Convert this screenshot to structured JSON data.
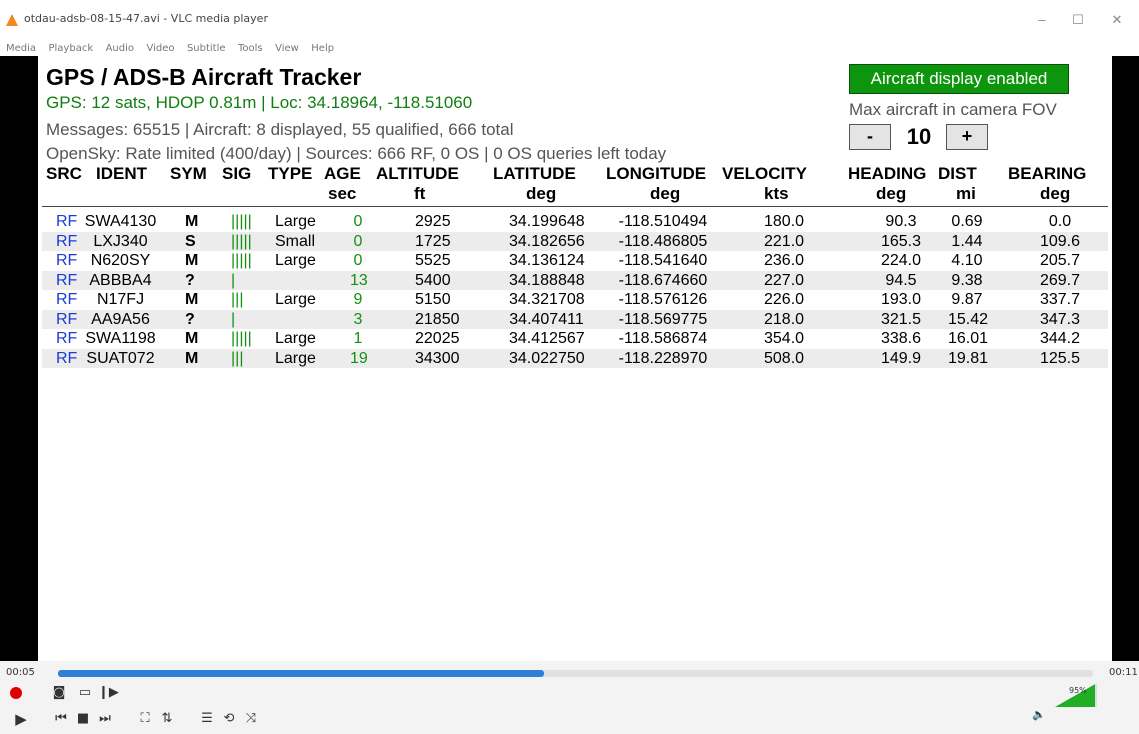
{
  "window": {
    "title": "otdau-adsb-08-15-47.avi - VLC media player",
    "minimize": "–",
    "maximize": "☐",
    "close": "✕"
  },
  "menu": [
    "Media",
    "Playback",
    "Audio",
    "Video",
    "Subtitle",
    "Tools",
    "View",
    "Help"
  ],
  "tracker": {
    "title": "GPS / ADS-B Aircraft Tracker",
    "gps_line": "GPS: 12 sats, HDOP 0.81m  |  Loc: 34.18964, -118.51060",
    "messages_line": "Messages: 65515  |  Aircraft: 8 displayed, 55 qualified, 666 total",
    "opensky_line": "OpenSky: Rate limited (400/day)  |  Sources: 666 RF, 0 OS  |  0 OS queries left today",
    "display_enabled": "Aircraft display enabled",
    "max_fov_label": "Max aircraft in camera FOV",
    "minus": "-",
    "plus": "+",
    "max_value": "10"
  },
  "table": {
    "headers": [
      "SRC",
      "IDENT",
      "SYM",
      "SIG",
      "TYPE",
      "AGE",
      "ALTITUDE",
      "LATITUDE",
      "LONGITUDE",
      "VELOCITY",
      "HEADING",
      "DIST",
      "BEARING"
    ],
    "units": [
      "",
      "",
      "",
      "",
      "",
      "sec",
      "ft",
      "deg",
      "deg",
      "kts",
      "deg",
      "mi",
      "deg"
    ],
    "rows": [
      [
        "RF",
        "SWA4130",
        "M",
        "|||||",
        "Large",
        "0",
        "2925",
        "34.199648",
        "-118.510494",
        "180.0",
        "90.3",
        "0.69",
        "0.0"
      ],
      [
        "RF",
        "LXJ340",
        "S",
        "|||||",
        "Small",
        "0",
        "1725",
        "34.182656",
        "-118.486805",
        "221.0",
        "165.3",
        "1.44",
        "109.6"
      ],
      [
        "RF",
        "N620SY",
        "M",
        "|||||",
        "Large",
        "0",
        "5525",
        "34.136124",
        "-118.541640",
        "236.0",
        "224.0",
        "4.10",
        "205.7"
      ],
      [
        "RF",
        "ABBBA4",
        "?",
        "|",
        "",
        "13",
        "5400",
        "34.188848",
        "-118.674660",
        "227.0",
        "94.5",
        "9.38",
        "269.7"
      ],
      [
        "RF",
        "N17FJ",
        "M",
        "|||",
        "Large",
        "9",
        "5150",
        "34.321708",
        "-118.576126",
        "226.0",
        "193.0",
        "9.87",
        "337.7"
      ],
      [
        "RF",
        "AA9A56",
        "?",
        "|",
        "",
        "3",
        "21850",
        "34.407411",
        "-118.569775",
        "218.0",
        "321.5",
        "15.42",
        "347.3"
      ],
      [
        "RF",
        "SWA1198",
        "M",
        "|||||",
        "Large",
        "1",
        "22025",
        "34.412567",
        "-118.586874",
        "354.0",
        "338.6",
        "16.01",
        "344.2"
      ],
      [
        "RF",
        "SUAT072",
        "M",
        "|||",
        "Large",
        "19",
        "34300",
        "34.022750",
        "-118.228970",
        "508.0",
        "149.9",
        "19.81",
        "125.5"
      ]
    ]
  },
  "player": {
    "elapsed": "00:05",
    "total": "00:11",
    "progress": 0.47,
    "volume": "95%"
  },
  "colors": {
    "src_blue": "#1c3bd8",
    "gps_green": "#107e10",
    "enabled_green": "#0d960d",
    "seek_blue": "#2f7fd7",
    "record_red": "#e00000"
  }
}
